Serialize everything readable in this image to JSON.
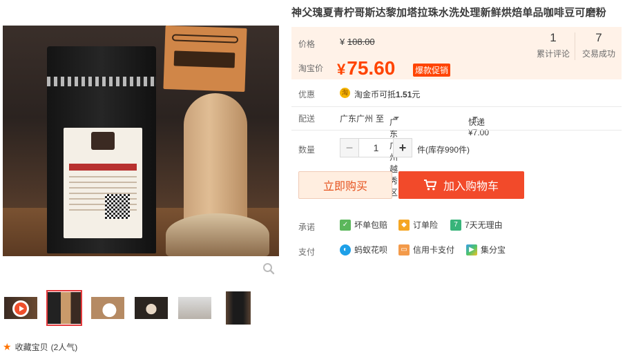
{
  "product": {
    "title": "神父瑰夏青柠哥斯达黎加塔拉珠水洗处理新鲜烘焙单品咖啡豆可磨粉"
  },
  "price": {
    "orig_label": "价格",
    "orig_currency": "¥",
    "orig_value": "108.00",
    "tb_label": "淘宝价",
    "tb_currency": "¥",
    "tb_value": "75.60",
    "promo_tag": "爆款促销"
  },
  "stats": [
    {
      "count": "1",
      "label": "累计评论"
    },
    {
      "count": "7",
      "label": "交易成功"
    }
  ],
  "promotion": {
    "label": "优惠",
    "coin_icon": "淘",
    "text_prefix": "淘金币可抵",
    "amount": "1.51",
    "text_suffix": "元"
  },
  "shipping": {
    "label": "配送",
    "from": "广东广州",
    "to_word": "至",
    "destination": "广东广州越秀区",
    "method": "快递 ¥7.00"
  },
  "quantity": {
    "label": "数量",
    "minus": "−",
    "value": "1",
    "plus": "+",
    "stock": "件(库存990件)"
  },
  "actions": {
    "buy_now": "立即购买",
    "add_to_cart": "加入购物车"
  },
  "promise": {
    "label": "承诺",
    "items": [
      "坏单包赔",
      "订单险",
      "7天无理由"
    ]
  },
  "payment": {
    "label": "支付",
    "items": [
      "蚂蚁花呗",
      "信用卡支付",
      "集分宝"
    ]
  },
  "favorite": {
    "text": "收藏宝贝",
    "popularity": "(2人气)"
  },
  "colors": {
    "accent": "#ff4400",
    "cart_button": "#f24a2a",
    "buy_now_bg": "#ffeee0",
    "price_bg": "#fff2e8"
  }
}
